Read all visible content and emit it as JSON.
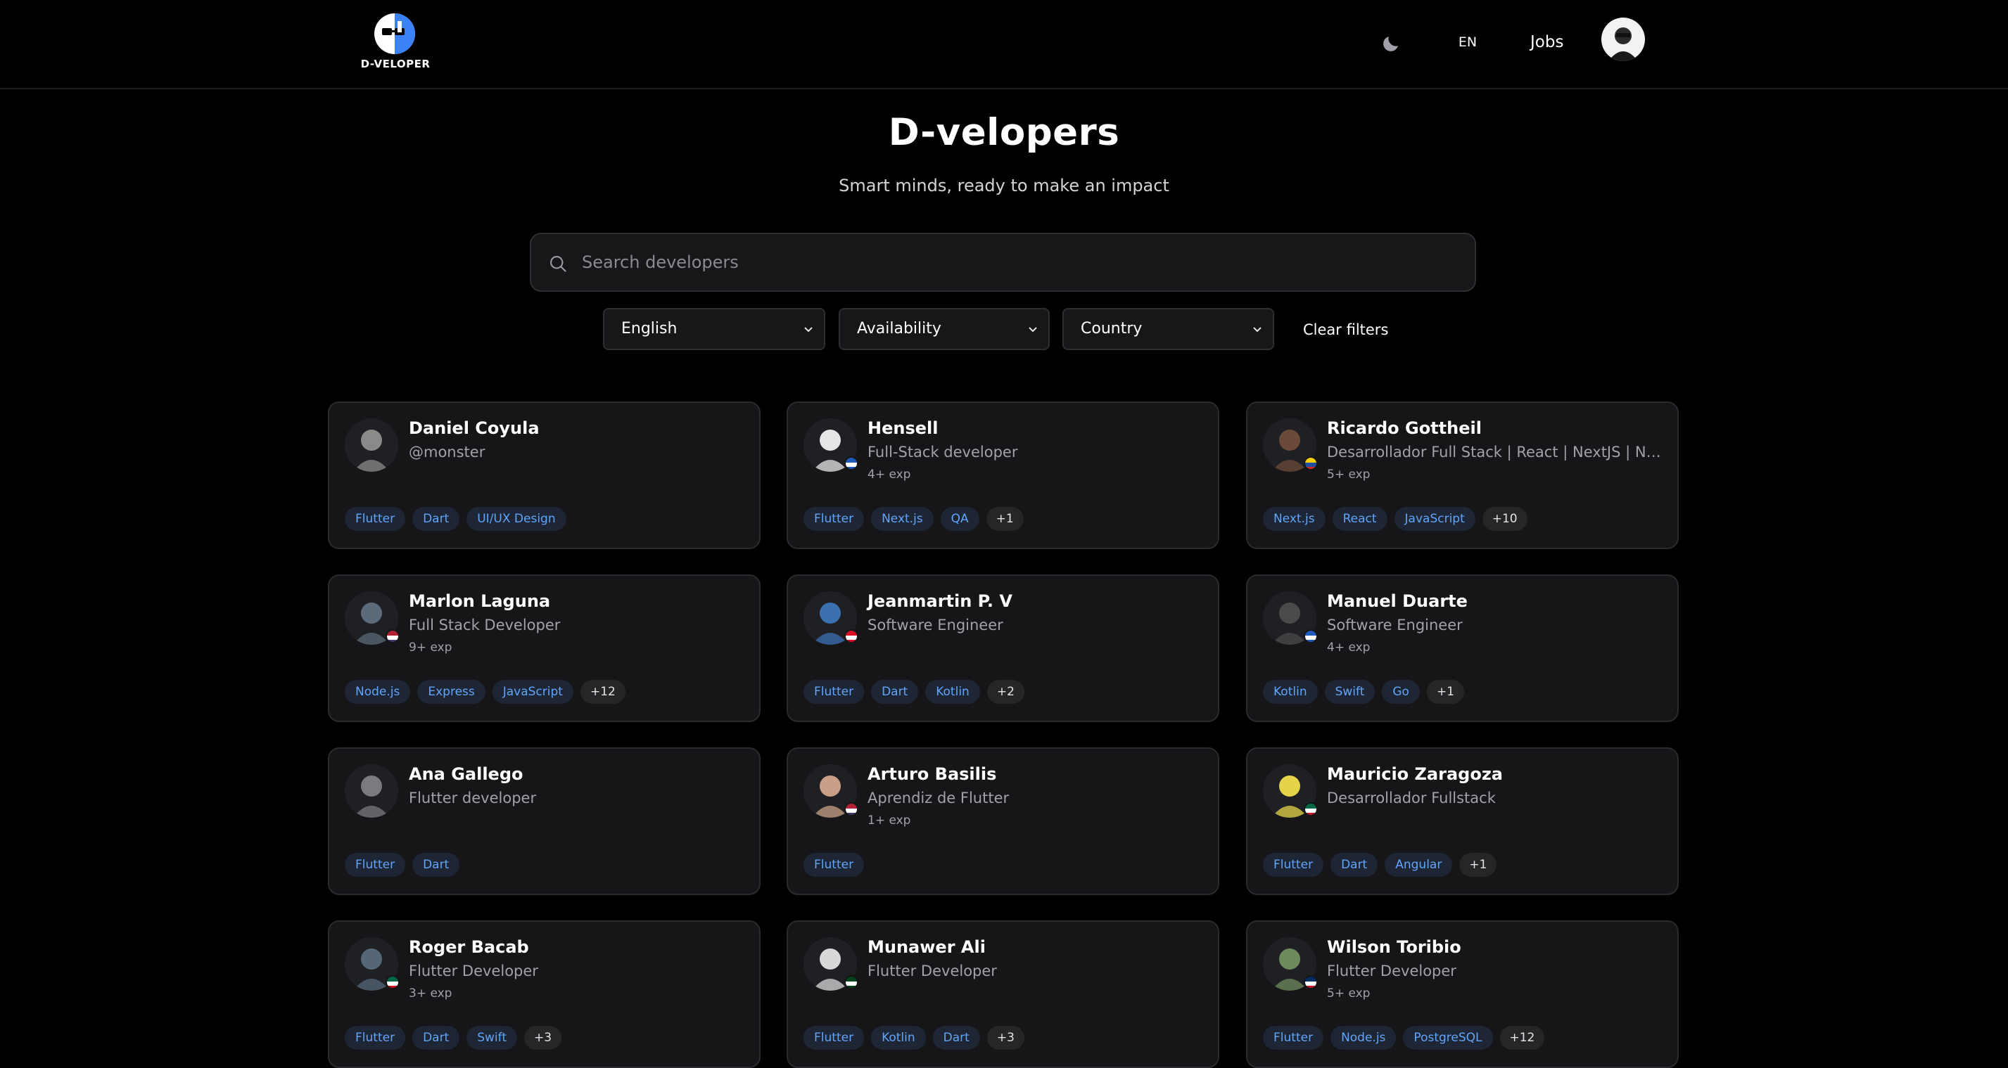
{
  "header": {
    "logo_text": "D-VELOPER",
    "lang": "EN",
    "jobs_label": "Jobs"
  },
  "hero": {
    "title": "D-velopers",
    "subtitle": "Smart minds, ready to make an impact"
  },
  "search": {
    "placeholder": "Search developers",
    "value": ""
  },
  "filters": {
    "language": "English",
    "availability": "Availability",
    "country": "Country",
    "clear_label": "Clear filters"
  },
  "developers": [
    {
      "name": "Daniel Coyula",
      "role": "@monster",
      "exp": "",
      "tags": [
        "Flutter",
        "Dart",
        "UI/UX Design"
      ],
      "more": "",
      "flag": "",
      "avatar_color": "#8a8a88"
    },
    {
      "name": "Hensell",
      "role": "Full-Stack developer",
      "exp": "4+ exp",
      "tags": [
        "Flutter",
        "Next.js",
        "QA"
      ],
      "more": "+1",
      "flag": "hn",
      "avatar_color": "#e5e5e5"
    },
    {
      "name": "Ricardo Gottheil",
      "role": "Desarrollador Full Stack | React | NextJS | NestJS | Node",
      "exp": "5+ exp",
      "tags": [
        "Next.js",
        "React",
        "JavaScript"
      ],
      "more": "+10",
      "flag": "co",
      "avatar_color": "#6b4a3a"
    },
    {
      "name": "Marlon Laguna",
      "role": "Full Stack Developer",
      "exp": "9+ exp",
      "tags": [
        "Node.js",
        "Express",
        "JavaScript"
      ],
      "more": "+12",
      "flag": "us",
      "avatar_color": "#5a6a78"
    },
    {
      "name": "Jeanmartin P. V",
      "role": "Software Engineer",
      "exp": "",
      "tags": [
        "Flutter",
        "Dart",
        "Kotlin"
      ],
      "more": "+2",
      "flag": "pe",
      "avatar_color": "#3b6fb0"
    },
    {
      "name": "Manuel Duarte",
      "role": "Software Engineer",
      "exp": "4+ exp",
      "tags": [
        "Kotlin",
        "Swift",
        "Go"
      ],
      "more": "+1",
      "flag": "hn",
      "avatar_color": "#4a4a4a"
    },
    {
      "name": "Ana Gallego",
      "role": "Flutter developer",
      "exp": "",
      "tags": [
        "Flutter",
        "Dart"
      ],
      "more": "",
      "flag": "",
      "avatar_color": "#7a7a80"
    },
    {
      "name": "Arturo Basilis",
      "role": "Aprendiz de Flutter",
      "exp": "1+ exp",
      "tags": [
        "Flutter"
      ],
      "more": "",
      "flag": "us",
      "avatar_color": "#c9a087"
    },
    {
      "name": "Mauricio Zaragoza",
      "role": "Desarrollador Fullstack",
      "exp": "",
      "tags": [
        "Flutter",
        "Dart",
        "Angular"
      ],
      "more": "+1",
      "flag": "mx",
      "avatar_color": "#e6d34a"
    },
    {
      "name": "Roger Bacab",
      "role": "Flutter Developer",
      "exp": "3+ exp",
      "tags": [
        "Flutter",
        "Dart",
        "Swift"
      ],
      "more": "+3",
      "flag": "mx",
      "avatar_color": "#556677"
    },
    {
      "name": "Munawer Ali",
      "role": "Flutter Developer",
      "exp": "",
      "tags": [
        "Flutter",
        "Kotlin",
        "Dart"
      ],
      "more": "+3",
      "flag": "pk",
      "avatar_color": "#d8d8d8"
    },
    {
      "name": "Wilson Toribio",
      "role": "Flutter Developer",
      "exp": "5+ exp",
      "tags": [
        "Flutter",
        "Node.js",
        "PostgreSQL"
      ],
      "more": "+12",
      "flag": "do",
      "avatar_color": "#6d8a5c"
    }
  ]
}
